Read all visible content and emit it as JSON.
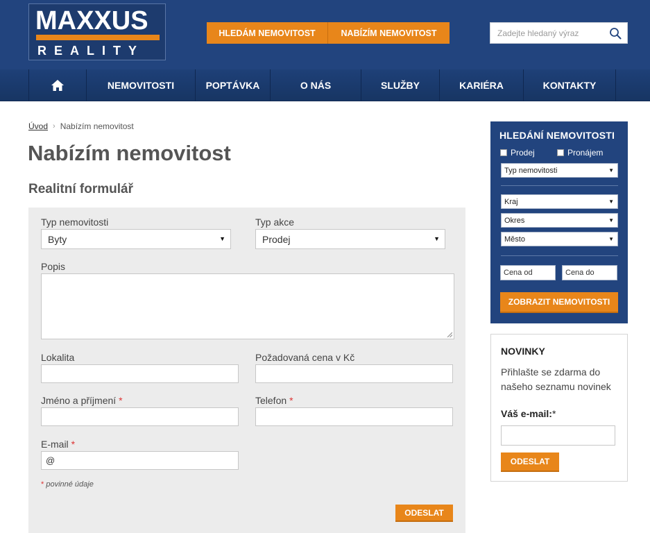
{
  "header": {
    "logo_top": "MAXXUS",
    "logo_bottom": "REALITY",
    "btn_search_property": "HLEDÁM NEMOVITOST",
    "btn_offer_property": "NABÍZÍM NEMOVITOST",
    "search_placeholder": "Zadejte hledaný výraz"
  },
  "nav": {
    "items": [
      "NEMOVITOSTI",
      "POPTÁVKA",
      "O NÁS",
      "SLUŽBY",
      "KARIÉRA",
      "KONTAKTY"
    ]
  },
  "breadcrumb": {
    "home": "Úvod",
    "current": "Nabízím nemovitost"
  },
  "page": {
    "title": "Nabízím nemovitost",
    "form_title": "Realitní formulář"
  },
  "form": {
    "property_type_label": "Typ nemovitosti",
    "property_type_value": "Byty",
    "action_type_label": "Typ akce",
    "action_type_value": "Prodej",
    "description_label": "Popis",
    "location_label": "Lokalita",
    "price_label": "Požadovaná cena v Kč",
    "name_label": "Jméno a příjmení",
    "phone_label": "Telefon",
    "email_label": "E-mail",
    "email_value": "@",
    "required_mark": "*",
    "required_note": "povinné údaje",
    "submit_label": "ODESLAT"
  },
  "sidebar_search": {
    "title": "HLEDÁNÍ NEMOVITOSTI",
    "check_sale": "Prodej",
    "check_rent": "Pronájem",
    "property_type": "Typ nemovitosti",
    "region": "Kraj",
    "district": "Okres",
    "city": "Město",
    "price_from": "Cena od",
    "price_to": "Cena do",
    "submit_label": "ZOBRAZIT NEMOVITOSTI"
  },
  "newsletter": {
    "title": "NOVINKY",
    "text": "Přihlašte se zdarma do našeho seznamu novinek",
    "email_label": "Váš e-mail:",
    "email_star": "*",
    "submit_label": "ODESLAT"
  },
  "colors": {
    "brand_blue": "#22447e",
    "accent_orange": "#e8861a"
  }
}
